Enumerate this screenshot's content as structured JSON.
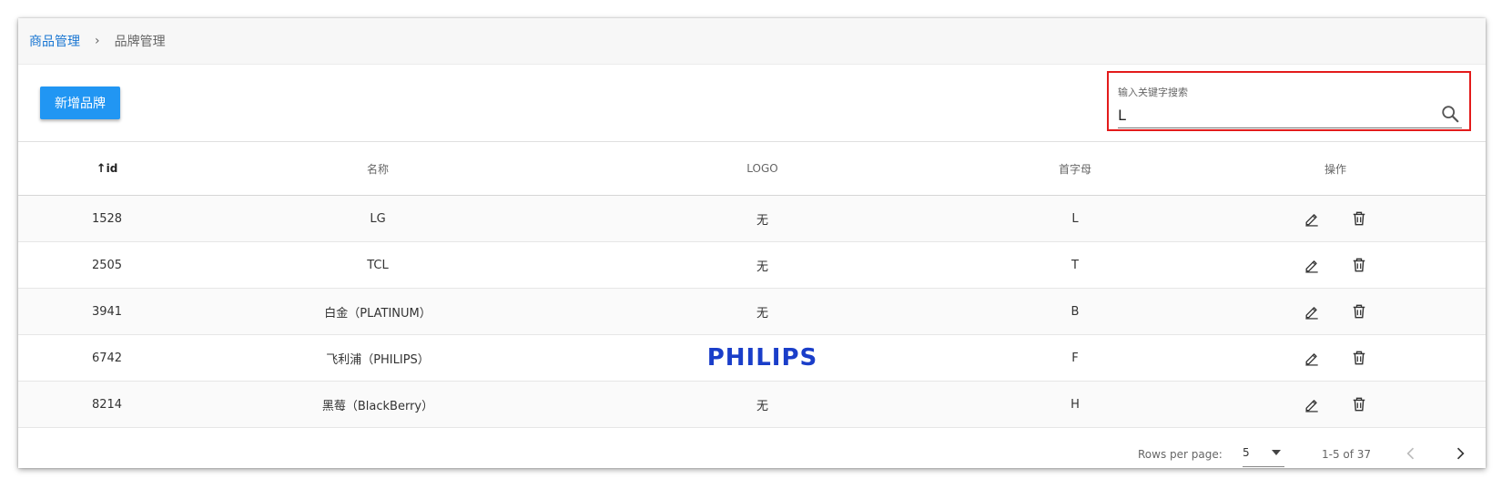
{
  "breadcrumb": {
    "parent": "商品管理",
    "separator": "›",
    "current": "品牌管理"
  },
  "toolbar": {
    "add_label": "新增品牌",
    "search_label": "输入关键字搜索",
    "search_value": "L",
    "highlight_color": "#e31b1b"
  },
  "table": {
    "headers": {
      "sort_icon": "↑",
      "id": "id",
      "name": "名称",
      "logo": "LOGO",
      "letter": "首字母",
      "actions": "操作"
    },
    "rows": [
      {
        "id": "1528",
        "name": "LG",
        "logo": "无",
        "letter": "L"
      },
      {
        "id": "2505",
        "name": "TCL",
        "logo": "无",
        "letter": "T"
      },
      {
        "id": "3941",
        "name": "白金（PLATINUM）",
        "logo": "无",
        "letter": "B"
      },
      {
        "id": "6742",
        "name": "飞利浦（PHILIPS）",
        "logo": "PHILIPS",
        "letter": "F"
      },
      {
        "id": "8214",
        "name": "黑莓（BlackBerry）",
        "logo": "无",
        "letter": "H"
      }
    ],
    "action_icons": [
      "edit-icon",
      "delete-icon"
    ]
  },
  "footer": {
    "rows_per_page_label": "Rows per page:",
    "rows_per_page_value": "5",
    "range": "1-5 of 37"
  },
  "colors": {
    "primary": "#2196f3",
    "link": "#1976d2",
    "logo_blue": "#1a3ec9"
  }
}
